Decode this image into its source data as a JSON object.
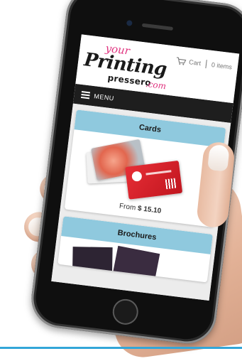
{
  "site": {
    "logo": {
      "your": "your",
      "printing": "Printing",
      "pressero": "pressero",
      "com": ".com"
    },
    "cart": {
      "icon": "cart-icon",
      "label": "Cart",
      "count": "0 items"
    },
    "menu": {
      "icon": "hamburger-icon",
      "label": "MENU"
    }
  },
  "products": [
    {
      "title": "Cards",
      "price_prefix": "From",
      "price": "$ 15.10"
    },
    {
      "title": "Brochures"
    }
  ],
  "colors": {
    "brand_pink": "#e0337f",
    "menu_bar": "#1e1e1e",
    "card_header": "#8fc9de",
    "bottom_rule": "#33a6d8"
  }
}
